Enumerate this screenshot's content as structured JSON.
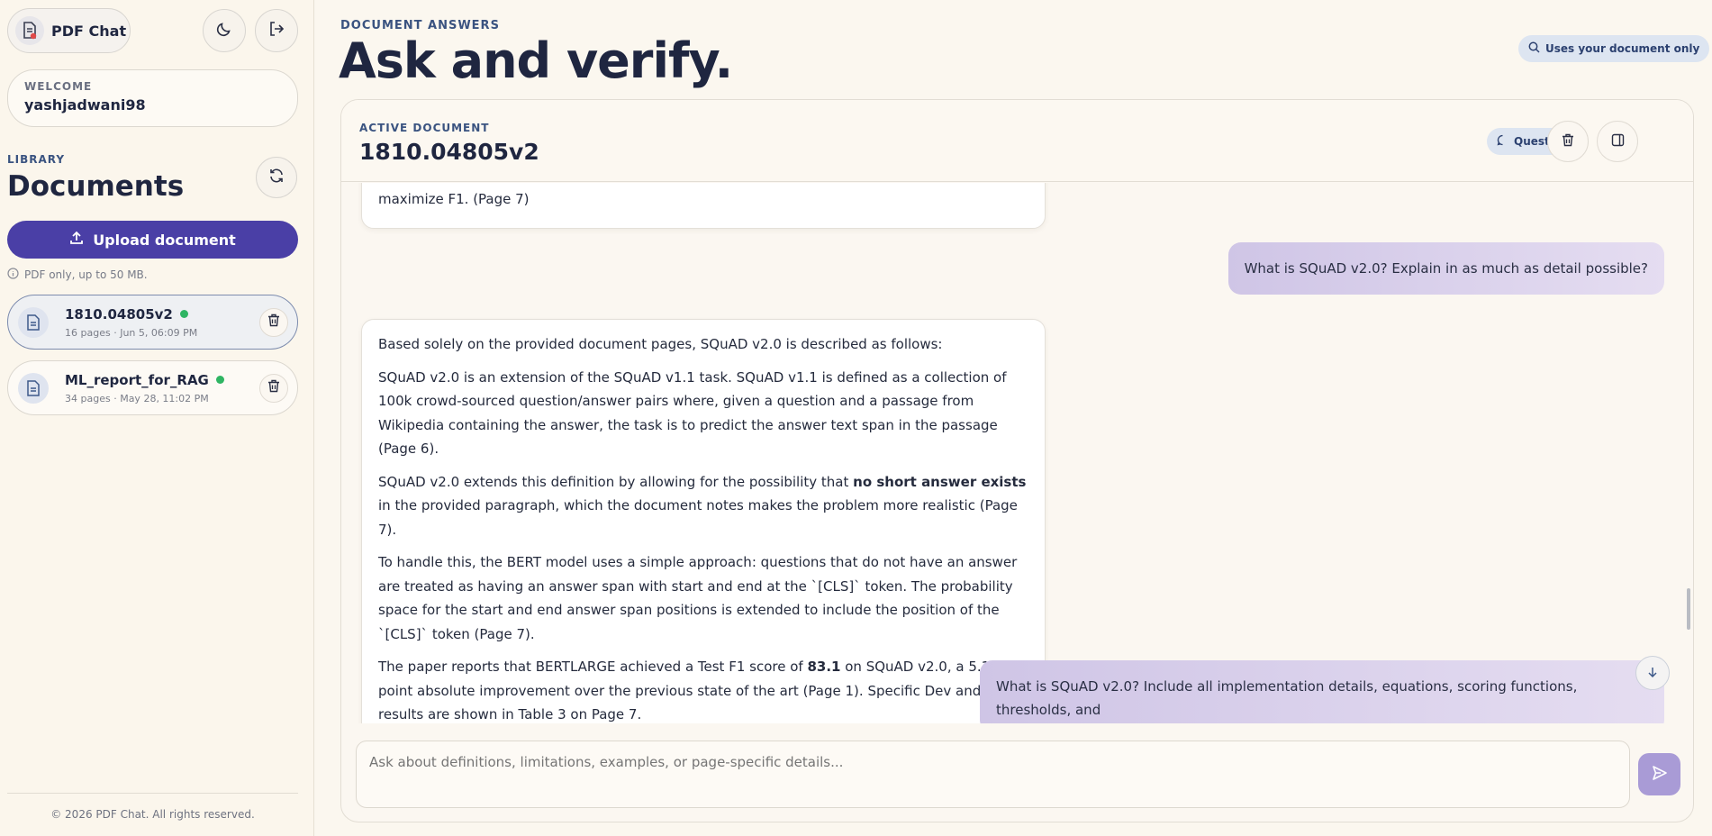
{
  "brand": {
    "name": "PDF Chat"
  },
  "welcome": {
    "label": "WELCOME",
    "username": "yashjadwani98"
  },
  "library": {
    "label": "LIBRARY",
    "title": "Documents",
    "upload_label": "Upload document",
    "upload_hint": "PDF only, up to 50 MB.",
    "documents": [
      {
        "name": "1810.04805v2",
        "pages": "16 pages",
        "date": "Jun 5, 06:09 PM",
        "status_color": "#2fb563",
        "active": true
      },
      {
        "name": "ML_report_for_RAG",
        "pages": "34 pages",
        "date": "May 28, 11:02 PM",
        "status_color": "#2fb563",
        "active": false
      }
    ]
  },
  "footer": {
    "text": "© 2026 PDF Chat. All rights reserved."
  },
  "header": {
    "eyebrow": "DOCUMENT ANSWERS",
    "title": "Ask and verify.",
    "scope_badge": "Uses your document only"
  },
  "panel": {
    "active_label": "ACTIVE DOCUMENT",
    "active_name": "1810.04805v2",
    "questions_label": "Questions"
  },
  "messages": {
    "partial_answer_tail": "maximize F1. (Page 7)",
    "user_1": "What is SQuAD v2.0? Explain in as much as detail possible?",
    "answer_2": {
      "p1": "Based solely on the provided document pages, SQuAD v2.0 is described as follows:",
      "p2": "SQuAD v2.0 is an extension of the SQuAD v1.1 task. SQuAD v1.1 is defined as a collection of 100k crowd-sourced question/answer pairs where, given a question and a passage from Wikipedia containing the answer, the task is to predict the answer text span in the passage (Page 6).",
      "p3_before": "SQuAD v2.0 extends this definition by allowing for the possibility that ",
      "p3_bold": "no short answer exists",
      "p3_after": " in the provided paragraph, which the document notes makes the problem more realistic (Page 7).",
      "p4": "To handle this, the BERT model uses a simple approach: questions that do not have an answer are treated as having an answer span with start and end at the `[CLS]` token. The probability space for the start and end answer span positions is extended to include the position of the `[CLS]` token (Page 7).",
      "p5_before": "The paper reports that BERTLARGE achieved a Test F1 score of ",
      "p5_bold": "83.1",
      "p5_after": " on SQuAD v2.0, a 5.1 point absolute improvement over the previous state of the art (Page 1). Specific Dev and Test results are shown in Table 3 on Page 7."
    },
    "user_2": "What is SQuAD v2.0? Include all implementation details, equations, scoring functions, thresholds, and"
  },
  "composer": {
    "placeholder": "Ask about definitions, limitations, examples, or page-specific details..."
  },
  "colors": {
    "accent": "#4a3fa6",
    "send": "#a99bd6",
    "user_bubble": "#d8cfec",
    "status": "#2fb563"
  },
  "icons": [
    "pdf-chat-logo-icon",
    "moon-icon",
    "logout-icon",
    "refresh-icon",
    "upload-icon",
    "info-icon",
    "file-icon",
    "trash-icon",
    "search-icon",
    "chat-bubble-icon",
    "sidebar-panel-icon",
    "arrow-down-icon",
    "send-icon"
  ]
}
